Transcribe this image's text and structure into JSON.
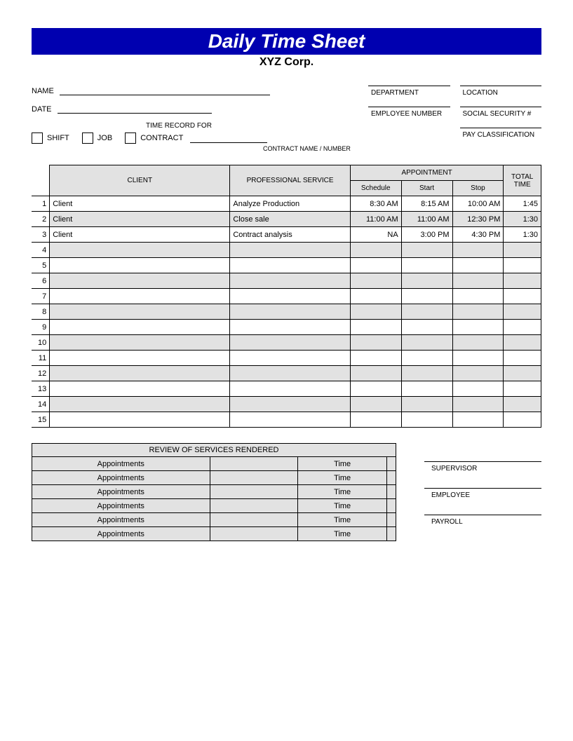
{
  "title": "Daily Time Sheet",
  "company": "XYZ Corp.",
  "fields": {
    "name_label": "NAME",
    "date_label": "DATE",
    "time_record_for": "TIME RECORD FOR",
    "shift": "SHIFT",
    "job": "JOB",
    "contract": "CONTRACT",
    "contract_caption": "CONTRACT NAME / NUMBER",
    "department": "DEPARTMENT",
    "location": "LOCATION",
    "employee_number": "EMPLOYEE NUMBER",
    "ssn": "SOCIAL SECURITY #",
    "pay_class": "PAY CLASSIFICATION"
  },
  "table": {
    "headers": {
      "client": "CLIENT",
      "service": "PROFESSIONAL SERVICE",
      "appointment": "APPOINTMENT",
      "schedule": "Schedule",
      "start": "Start",
      "stop": "Stop",
      "total": "TOTAL TIME"
    },
    "rows": [
      {
        "n": "1",
        "client": "Client",
        "service": "Analyze Production",
        "schedule": "8:30 AM",
        "start": "8:15 AM",
        "stop": "10:00 AM",
        "total": "1:45"
      },
      {
        "n": "2",
        "client": "Client",
        "service": "Close sale",
        "schedule": "11:00 AM",
        "start": "11:00 AM",
        "stop": "12:30 PM",
        "total": "1:30"
      },
      {
        "n": "3",
        "client": "Client",
        "service": "Contract analysis",
        "schedule": "NA",
        "start": "3:00 PM",
        "stop": "4:30 PM",
        "total": "1:30"
      },
      {
        "n": "4",
        "client": "",
        "service": "",
        "schedule": "",
        "start": "",
        "stop": "",
        "total": ""
      },
      {
        "n": "5",
        "client": "",
        "service": "",
        "schedule": "",
        "start": "",
        "stop": "",
        "total": ""
      },
      {
        "n": "6",
        "client": "",
        "service": "",
        "schedule": "",
        "start": "",
        "stop": "",
        "total": ""
      },
      {
        "n": "7",
        "client": "",
        "service": "",
        "schedule": "",
        "start": "",
        "stop": "",
        "total": ""
      },
      {
        "n": "8",
        "client": "",
        "service": "",
        "schedule": "",
        "start": "",
        "stop": "",
        "total": ""
      },
      {
        "n": "9",
        "client": "",
        "service": "",
        "schedule": "",
        "start": "",
        "stop": "",
        "total": ""
      },
      {
        "n": "10",
        "client": "",
        "service": "",
        "schedule": "",
        "start": "",
        "stop": "",
        "total": ""
      },
      {
        "n": "11",
        "client": "",
        "service": "",
        "schedule": "",
        "start": "",
        "stop": "",
        "total": ""
      },
      {
        "n": "12",
        "client": "",
        "service": "",
        "schedule": "",
        "start": "",
        "stop": "",
        "total": ""
      },
      {
        "n": "13",
        "client": "",
        "service": "",
        "schedule": "",
        "start": "",
        "stop": "",
        "total": ""
      },
      {
        "n": "14",
        "client": "",
        "service": "",
        "schedule": "",
        "start": "",
        "stop": "",
        "total": ""
      },
      {
        "n": "15",
        "client": "",
        "service": "",
        "schedule": "",
        "start": "",
        "stop": "",
        "total": ""
      }
    ]
  },
  "review": {
    "title": "REVIEW OF SERVICES RENDERED",
    "appt_label": "Appointments",
    "time_label": "Time",
    "row_count": 6
  },
  "signatures": {
    "supervisor": "SUPERVISOR",
    "employee": "EMPLOYEE",
    "payroll": "PAYROLL"
  }
}
